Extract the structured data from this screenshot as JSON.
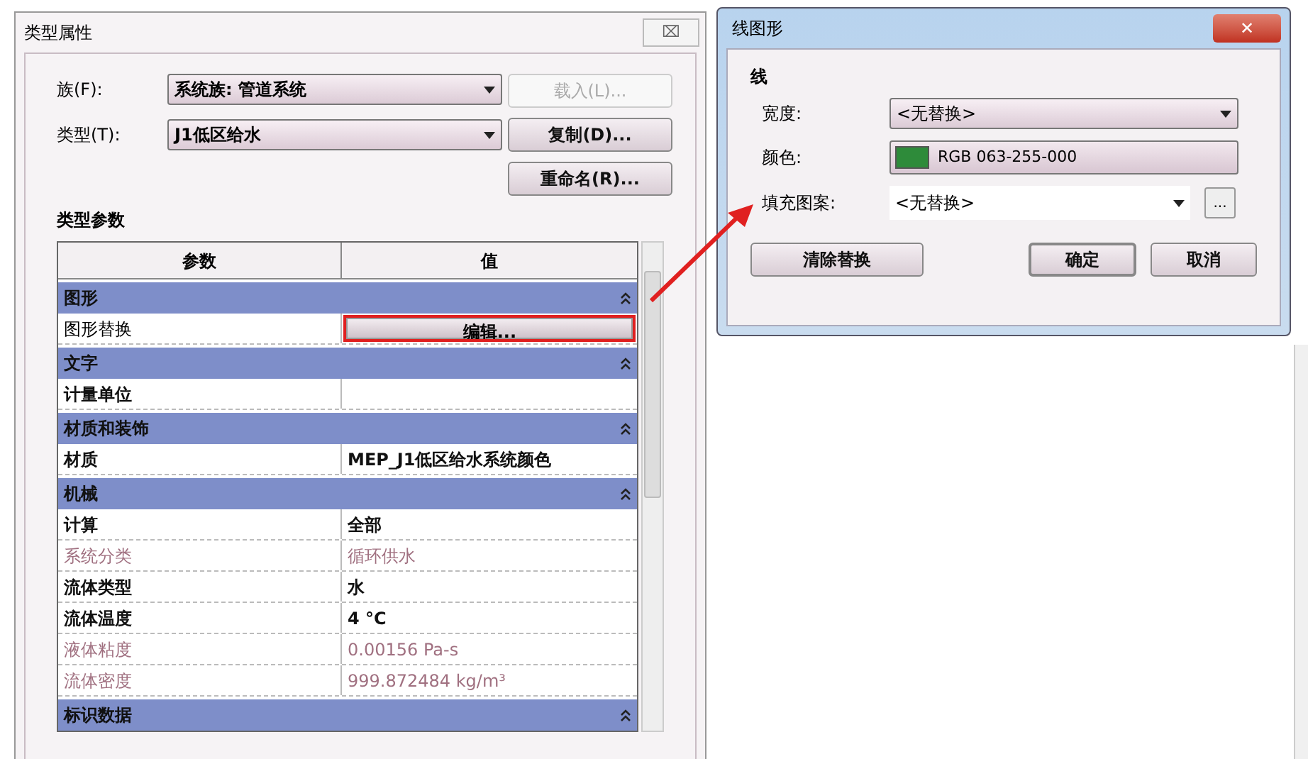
{
  "type_dialog": {
    "title": "类型属性",
    "close": "⌧",
    "family": {
      "label": "族(F):",
      "value": "系统族: 管道系统"
    },
    "type": {
      "label": "类型(T):",
      "value": "J1低区给水"
    },
    "buttons": [
      {
        "label": "载入(L)...",
        "disabled": true
      },
      {
        "label": "复制(D)...",
        "disabled": false
      },
      {
        "label": "重命名(R)...",
        "disabled": false
      }
    ],
    "section_label": "类型参数",
    "table": {
      "columns": [
        "参数",
        "值"
      ],
      "rows": [
        {
          "kind": "group",
          "label": "图形",
          "expanded": true
        },
        {
          "kind": "button",
          "name": "图形替换",
          "value": "编辑...",
          "highlighted": true
        },
        {
          "kind": "group",
          "label": "文字",
          "expanded": true
        },
        {
          "kind": "param",
          "name": "计量单位",
          "value": "",
          "disabled": false
        },
        {
          "kind": "group",
          "label": "材质和装饰",
          "expanded": true
        },
        {
          "kind": "param",
          "name": "材质",
          "value": "MEP_J1低区给水系统颜色",
          "disabled": false
        },
        {
          "kind": "group",
          "label": "机械",
          "expanded": true
        },
        {
          "kind": "param",
          "name": "计算",
          "value": "全部",
          "disabled": false
        },
        {
          "kind": "param",
          "name": "系统分类",
          "value": "循环供水",
          "disabled": true
        },
        {
          "kind": "param",
          "name": "流体类型",
          "value": "水",
          "disabled": false
        },
        {
          "kind": "param",
          "name": "流体温度",
          "value": "4 °C",
          "disabled": false
        },
        {
          "kind": "param",
          "name": "液体粘度",
          "value": "0.00156 Pa-s",
          "disabled": true
        },
        {
          "kind": "param",
          "name": "流体密度",
          "value": "999.872484 kg/m³",
          "disabled": true
        },
        {
          "kind": "group",
          "label": "标识数据",
          "expanded": true
        }
      ]
    }
  },
  "line_dialog": {
    "title": "线图形",
    "close": "✕",
    "group_label": "线",
    "width": {
      "label": "宽度:",
      "value": "<无替换>"
    },
    "color": {
      "label": "颜色:",
      "value": "RGB 063-255-000",
      "color": "#2e8b3a"
    },
    "fill": {
      "label": "填充图案:",
      "value": "<无替换>",
      "browse": "..."
    },
    "buttons": [
      {
        "label": "清除替换",
        "default": false
      },
      {
        "label": "确定",
        "default": true
      },
      {
        "label": "取消",
        "default": false
      }
    ]
  }
}
